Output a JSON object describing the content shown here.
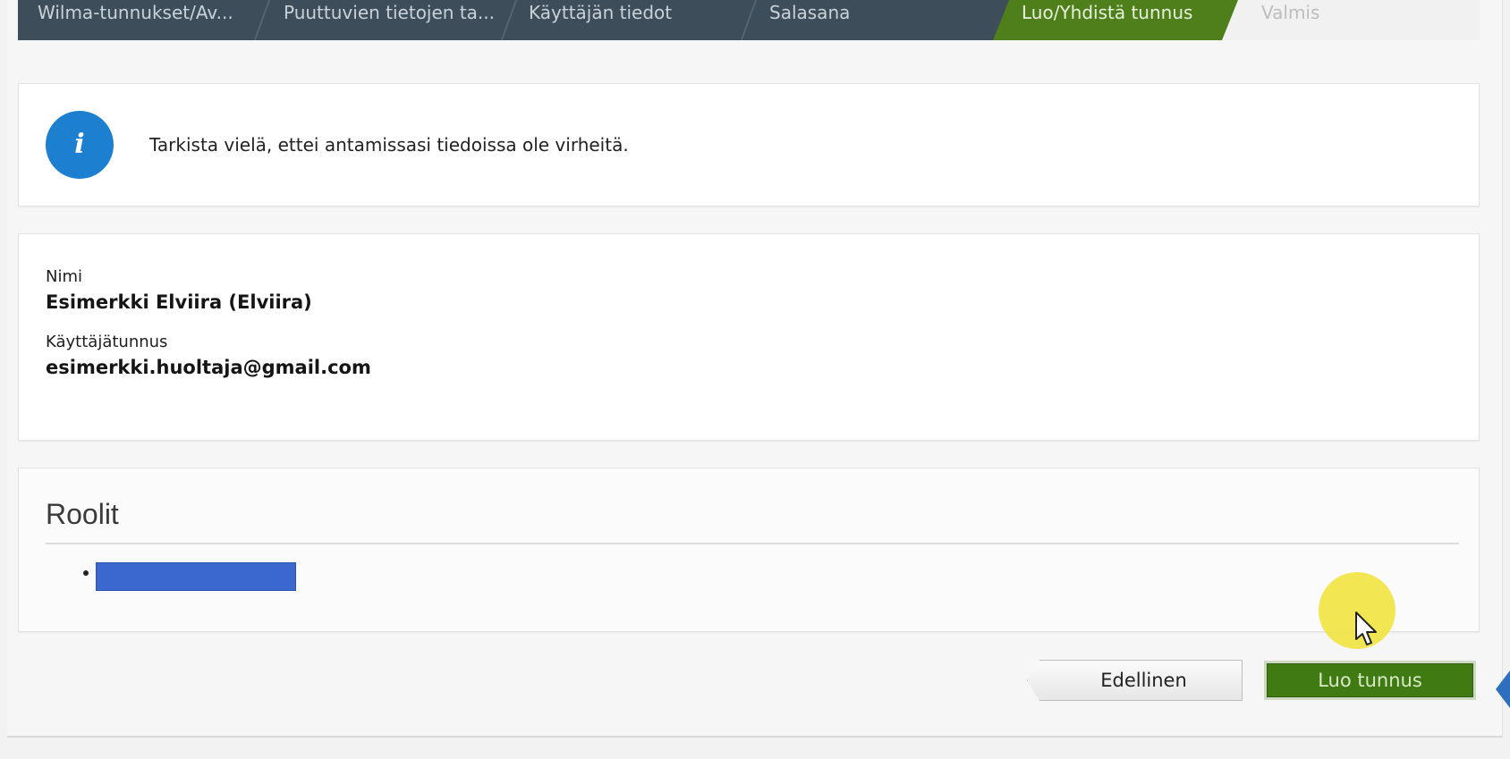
{
  "steps": [
    {
      "label": "Wilma-tunnukset/Av..."
    },
    {
      "label": "Puuttuvien tietojen ta..."
    },
    {
      "label": "Käyttäjän tiedot"
    },
    {
      "label": "Salasana"
    },
    {
      "label": "Luo/Yhdistä tunnus"
    },
    {
      "label": "Valmis"
    }
  ],
  "info": {
    "icon": "info-icon",
    "glyph": "i",
    "message": "Tarkista vielä, ettei antamissasi tiedoissa ole virheitä."
  },
  "user": {
    "name_label": "Nimi",
    "name_value": "Esimerkki Elviira (Elviira)",
    "username_label": "Käyttäjätunnus",
    "username_value": "esimerkki.huoltaja@gmail.com"
  },
  "roles": {
    "title": "Roolit"
  },
  "buttons": {
    "previous": "Edellinen",
    "create": "Luo tunnus"
  },
  "colors": {
    "step_bar": "#3d4d5a",
    "active_step": "#4e7f1a",
    "info_icon": "#1c7fcf",
    "create_button": "#3f7a12",
    "redaction": "#3b68cc"
  }
}
